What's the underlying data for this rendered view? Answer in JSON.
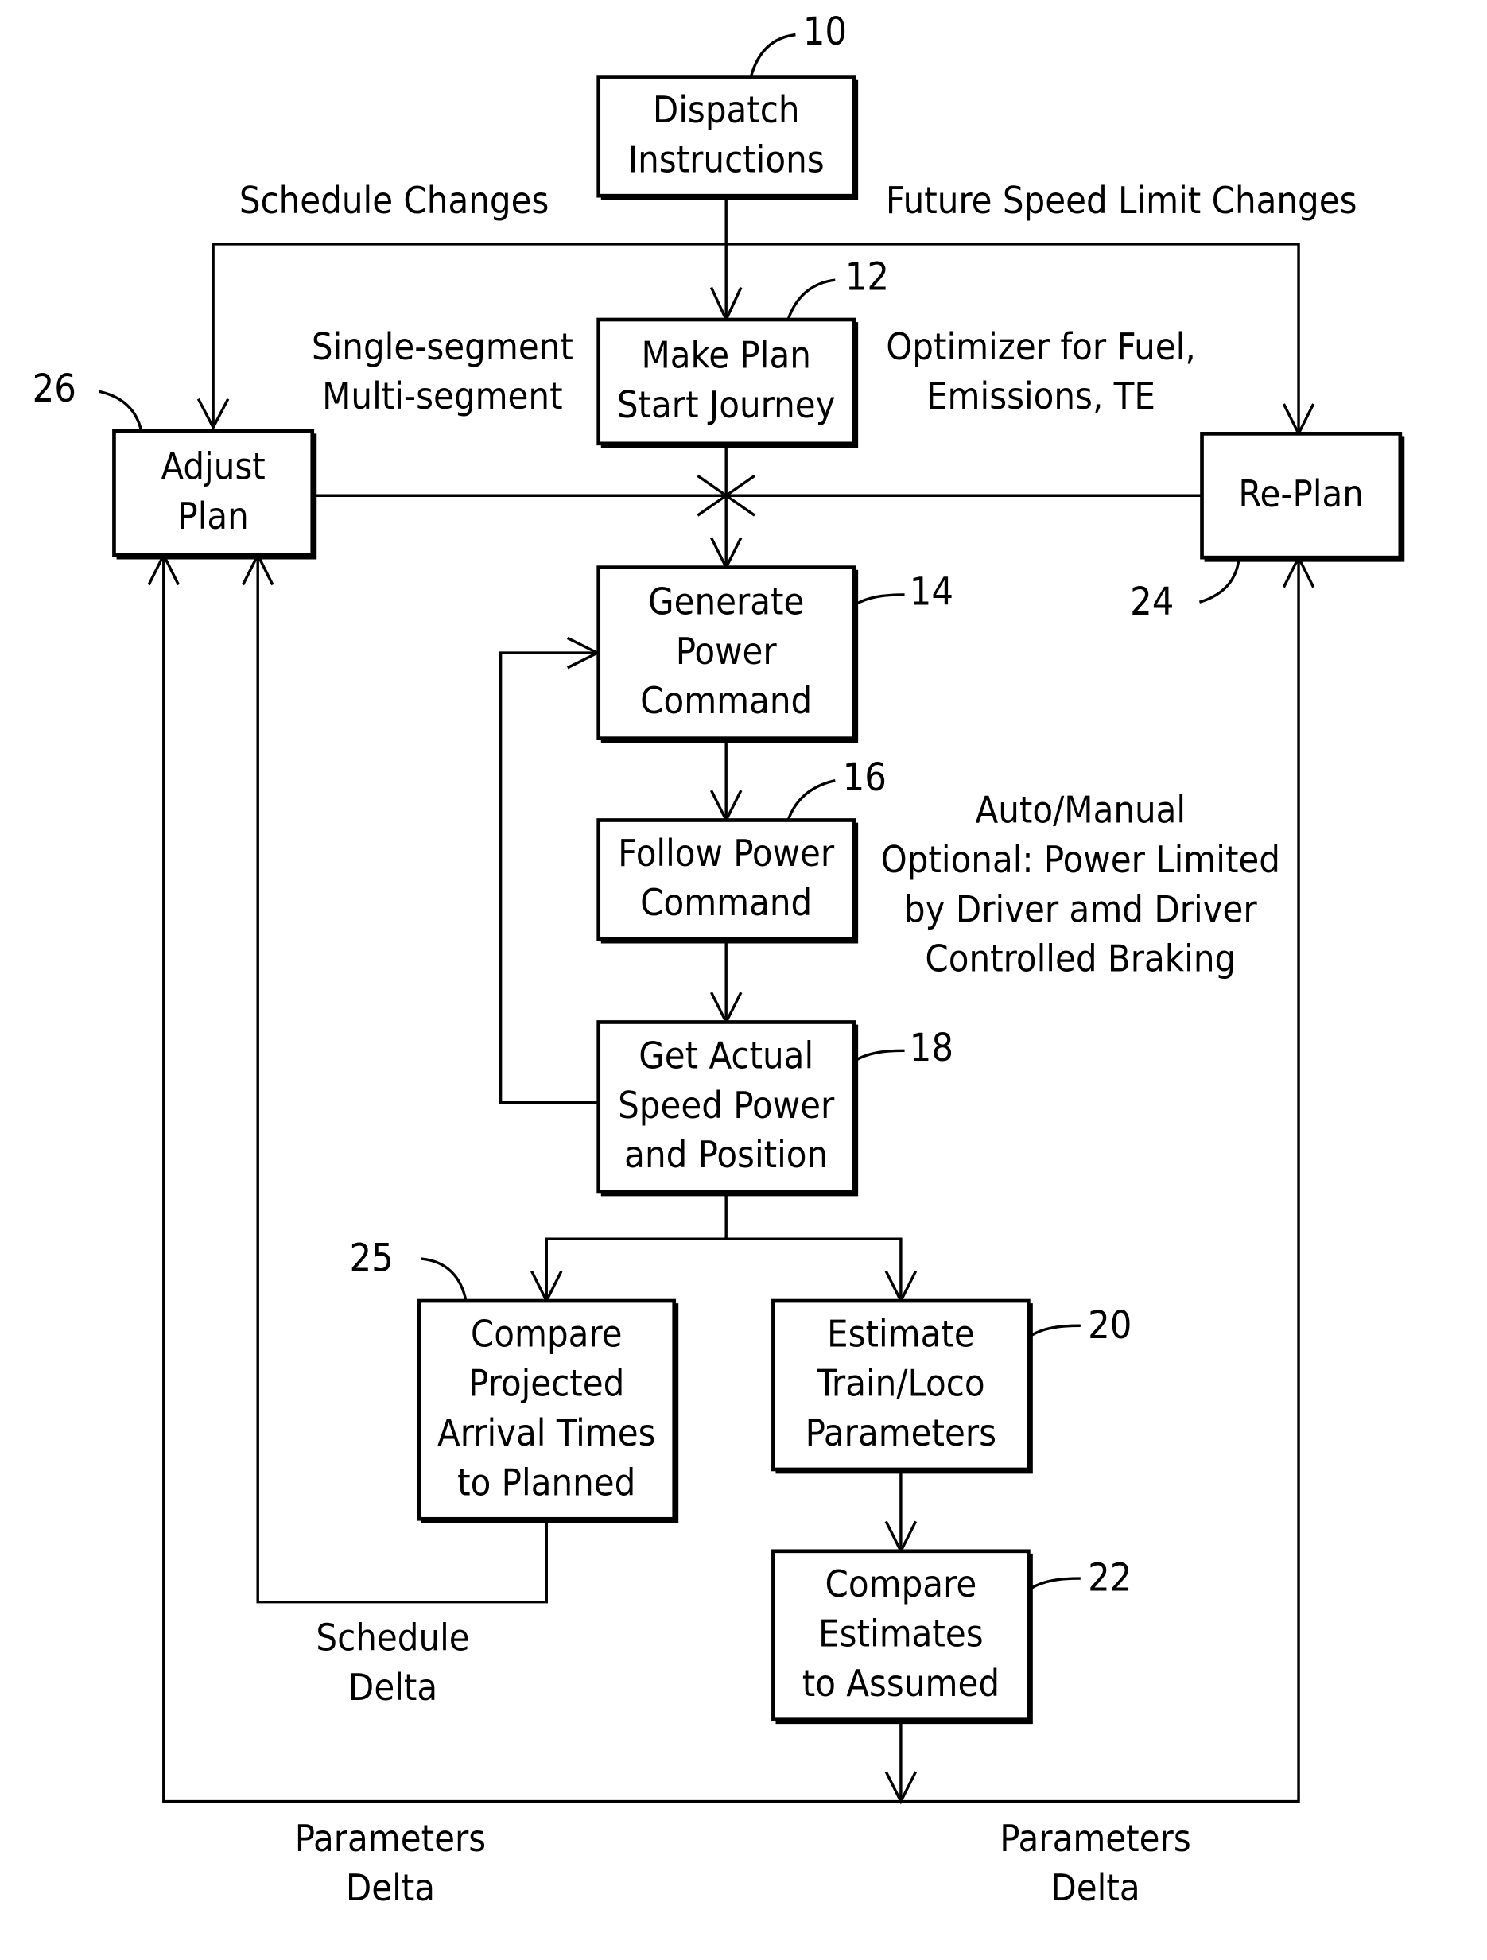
{
  "diagram": {
    "nodes": {
      "dispatch": {
        "ref": "10",
        "lines": [
          "Dispatch",
          "Instructions"
        ]
      },
      "make_plan": {
        "ref": "12",
        "lines": [
          "Make Plan",
          "Start Journey"
        ]
      },
      "generate": {
        "ref": "14",
        "lines": [
          "Generate",
          "Power",
          "Command"
        ]
      },
      "follow": {
        "ref": "16",
        "lines": [
          "Follow Power",
          "Command"
        ]
      },
      "get_actual": {
        "ref": "18",
        "lines": [
          "Get Actual",
          "Speed Power",
          "and Position"
        ]
      },
      "estimate": {
        "ref": "20",
        "lines": [
          "Estimate",
          "Train/Loco",
          "Parameters"
        ]
      },
      "compare_est": {
        "ref": "22",
        "lines": [
          "Compare",
          "Estimates",
          "to Assumed"
        ]
      },
      "replan": {
        "ref": "24",
        "lines": [
          "Re-Plan"
        ]
      },
      "compare_proj": {
        "ref": "25",
        "lines": [
          "Compare",
          "Projected",
          "Arrival Times",
          "to Planned"
        ]
      },
      "adjust": {
        "ref": "26",
        "lines": [
          "Adjust",
          "Plan"
        ]
      }
    },
    "labels": {
      "schedule_changes": "Schedule Changes",
      "future_speed": "Future Speed Limit Changes",
      "segment": [
        "Single-segment",
        "Multi-segment"
      ],
      "optimizer": [
        "Optimizer for Fuel,",
        "Emissions, TE"
      ],
      "auto_manual": [
        "Auto/Manual",
        "Optional: Power Limited",
        "by Driver amd Driver",
        "Controlled Braking"
      ],
      "schedule_delta": [
        "Schedule",
        "Delta"
      ],
      "params_delta_left": [
        "Parameters",
        "Delta"
      ],
      "params_delta_right": [
        "Parameters",
        "Delta"
      ]
    }
  }
}
